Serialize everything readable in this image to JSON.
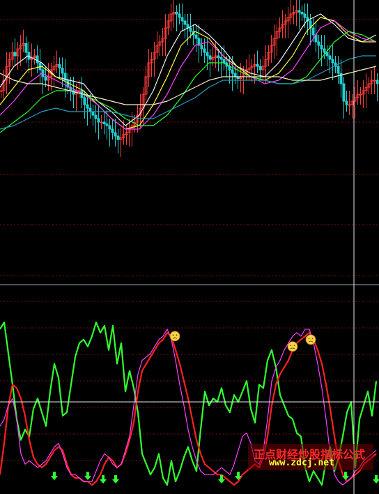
{
  "watermark": {
    "title": "正点财经炒股指标公式",
    "url": "www.zdcj.net"
  },
  "colors": {
    "background": "#000000",
    "grid": "#7a1010",
    "separator": "#9aa0b0",
    "candle_up": "#ff3b3b",
    "candle_down": "#22d0d0",
    "ma_white": "#f0f0f0",
    "ma_yellow": "#ffff40",
    "ma_magenta": "#ff40ff",
    "ma_green": "#30ff30",
    "ma_cyan": "#22a0c0",
    "ma_long": "#f5f0c0",
    "osc_green": "#30ff30",
    "osc_red": "#ff2020",
    "osc_magenta": "#ff40ff",
    "signal_arrow": "#30ff30",
    "warning_face": "#ffd24a"
  },
  "chart_data": [
    {
      "type": "candlestick",
      "panel": "price",
      "grid": true,
      "legend": "none",
      "ylim": [
        0,
        100
      ],
      "x": [
        0,
        4,
        8,
        12,
        16,
        20,
        24,
        28,
        32,
        36,
        40,
        44,
        48,
        52,
        56,
        60,
        64,
        68,
        72,
        76,
        80,
        84,
        88,
        92,
        96,
        100,
        104,
        108,
        112,
        116,
        120,
        124,
        128,
        132,
        136,
        140,
        144,
        148,
        152,
        156,
        160,
        164,
        168,
        172,
        176,
        180,
        184,
        188,
        192,
        196,
        200,
        204,
        208,
        212,
        216,
        220,
        224,
        228,
        232,
        236,
        240,
        244,
        248,
        252,
        256,
        260,
        264,
        268,
        272,
        276,
        280,
        284,
        288,
        292,
        296,
        300,
        304,
        308,
        312,
        316,
        320,
        324,
        328,
        332,
        336,
        340,
        344,
        348,
        352,
        356,
        360,
        364,
        368,
        372,
        376,
        380,
        384,
        388,
        392,
        396,
        400,
        404,
        408,
        412,
        416,
        420,
        424,
        428,
        432,
        436,
        440,
        444,
        448,
        452,
        456,
        460,
        464,
        468,
        472,
        476,
        480,
        484,
        488,
        492,
        496,
        500,
        504,
        508,
        512,
        516,
        520,
        524,
        528,
        532,
        536,
        540
      ],
      "close": [
        52,
        58,
        66,
        70,
        74,
        72,
        76,
        78,
        79,
        74,
        70,
        71,
        72,
        68,
        64,
        60,
        58,
        60,
        64,
        66,
        67,
        65,
        62,
        58,
        54,
        52,
        50,
        52,
        52,
        48,
        44,
        42,
        40,
        38,
        36,
        34,
        34,
        33,
        32,
        30,
        28,
        26,
        24,
        25,
        27,
        28,
        30,
        32,
        34,
        38,
        42,
        50,
        60,
        68,
        70,
        74,
        78,
        80,
        82,
        88,
        92,
        96,
        97,
        96,
        94,
        92,
        90,
        88,
        86,
        84,
        82,
        78,
        76,
        74,
        72,
        70,
        71,
        72,
        71,
        70,
        68,
        66,
        64,
        62,
        60,
        59,
        60,
        62,
        64,
        65,
        66,
        67,
        66,
        64,
        66,
        70,
        74,
        78,
        82,
        86,
        88,
        90,
        92,
        94,
        96,
        97,
        98,
        97,
        96,
        94,
        92,
        88,
        84,
        80,
        78,
        76,
        74,
        72,
        70,
        68,
        66,
        62,
        56,
        46,
        44,
        44,
        46,
        48,
        50,
        50,
        52,
        54,
        56,
        58,
        58,
        56
      ]
    },
    {
      "type": "line",
      "panel": "price-overlays",
      "series_count": 6,
      "ylim": [
        0,
        100
      ],
      "x": [
        0,
        20,
        40,
        60,
        80,
        100,
        120,
        140,
        160,
        180,
        200,
        220,
        240,
        260,
        280,
        300,
        320,
        340,
        360,
        380,
        400,
        420,
        440,
        460,
        480,
        500,
        520,
        540
      ],
      "series": [
        {
          "values": [
            54,
            66,
            72,
            68,
            60,
            58,
            56,
            46,
            40,
            32,
            38,
            52,
            72,
            86,
            90,
            84,
            76,
            66,
            62,
            60,
            68,
            80,
            92,
            96,
            90,
            82,
            80,
            84
          ]
        },
        {
          "values": [
            44,
            54,
            64,
            66,
            60,
            56,
            52,
            44,
            36,
            30,
            32,
            44,
            60,
            78,
            86,
            82,
            72,
            66,
            60,
            58,
            62,
            72,
            86,
            94,
            92,
            84,
            80,
            80
          ]
        },
        {
          "values": [
            38,
            46,
            56,
            62,
            58,
            54,
            50,
            44,
            36,
            30,
            30,
            38,
            50,
            66,
            78,
            80,
            72,
            64,
            60,
            56,
            58,
            64,
            76,
            88,
            92,
            86,
            82,
            80
          ]
        },
        {
          "values": [
            28,
            34,
            40,
            48,
            52,
            52,
            50,
            46,
            42,
            36,
            32,
            32,
            38,
            48,
            60,
            68,
            68,
            64,
            60,
            58,
            56,
            56,
            60,
            70,
            80,
            86,
            84,
            80
          ]
        },
        {
          "values": [
            30,
            32,
            36,
            40,
            42,
            40,
            40,
            40,
            40,
            38,
            36,
            36,
            40,
            44,
            48,
            54,
            58,
            58,
            58,
            58,
            56,
            56,
            58,
            62,
            66,
            70,
            72,
            72
          ]
        },
        {
          "values": [
            62,
            58,
            56,
            56,
            54,
            52,
            50,
            48,
            46,
            44,
            44,
            44,
            46,
            50,
            54,
            58,
            60,
            60,
            60,
            60,
            60,
            58,
            58,
            58,
            60,
            62,
            64,
            66
          ]
        }
      ]
    },
    {
      "type": "line",
      "panel": "oscillator",
      "grid": true,
      "legend": "none",
      "ylim": [
        0,
        100
      ],
      "x": [
        0,
        6,
        12,
        18,
        24,
        30,
        36,
        42,
        48,
        54,
        60,
        66,
        72,
        78,
        84,
        90,
        96,
        102,
        108,
        114,
        120,
        126,
        132,
        138,
        144,
        150,
        156,
        162,
        168,
        174,
        180,
        186,
        192,
        198,
        204,
        210,
        216,
        222,
        228,
        234,
        240,
        246,
        252,
        258,
        264,
        270,
        276,
        282,
        288,
        294,
        300,
        306,
        312,
        318,
        324,
        330,
        336,
        342,
        348,
        354,
        360,
        366,
        372,
        378,
        384,
        390,
        396,
        402,
        408,
        414,
        420,
        426,
        432,
        438,
        444,
        450,
        456,
        462,
        468,
        474,
        480,
        486,
        492,
        498,
        504,
        510,
        516,
        522,
        528,
        534,
        540
      ],
      "series": [
        {
          "values": [
            92,
            96,
            78,
            60,
            40,
            28,
            34,
            30,
            46,
            52,
            44,
            36,
            56,
            72,
            64,
            42,
            44,
            60,
            76,
            84,
            86,
            82,
            88,
            96,
            90,
            94,
            80,
            94,
            72,
            84,
            56,
            68,
            58,
            44,
            20,
            14,
            8,
            12,
            20,
            6,
            2,
            16,
            4,
            10,
            18,
            24,
            16,
            10,
            34,
            56,
            48,
            52,
            50,
            58,
            48,
            44,
            54,
            50,
            56,
            62,
            46,
            38,
            60,
            58,
            74,
            80,
            70,
            54,
            48,
            42,
            40,
            32,
            30,
            12,
            4,
            10,
            6,
            2,
            16,
            24,
            10,
            18,
            30,
            44,
            50,
            12,
            40,
            48,
            56,
            42,
            62
          ]
        },
        {
          "values": [
            8,
            26,
            48,
            60,
            58,
            52,
            42,
            28,
            18,
            14,
            12,
            14,
            18,
            22,
            24,
            22,
            14,
            8,
            6,
            6,
            4,
            4,
            2,
            4,
            8,
            14,
            18,
            16,
            12,
            14,
            20,
            28,
            38,
            56,
            68,
            72,
            76,
            80,
            84,
            86,
            90,
            88,
            80,
            72,
            62,
            52,
            40,
            28,
            20,
            14,
            12,
            10,
            8,
            8,
            6,
            4,
            2,
            4,
            8,
            10,
            12,
            14,
            12,
            18,
            30,
            48,
            60,
            66,
            70,
            74,
            80,
            84,
            86,
            88,
            90,
            86,
            80,
            72,
            60,
            46,
            30,
            16,
            8,
            4,
            6,
            8,
            10,
            14,
            16,
            18,
            20
          ]
        },
        {
          "values": [
            36,
            40,
            48,
            52,
            40,
            20,
            14,
            16,
            14,
            12,
            14,
            16,
            20,
            24,
            26,
            20,
            12,
            8,
            8,
            6,
            4,
            4,
            4,
            10,
            16,
            20,
            18,
            14,
            12,
            14,
            22,
            30,
            48,
            66,
            74,
            76,
            78,
            82,
            86,
            88,
            92,
            86,
            74,
            60,
            48,
            34,
            24,
            16,
            10,
            8,
            8,
            8,
            10,
            12,
            10,
            8,
            14,
            22,
            30,
            32,
            26,
            16,
            14,
            22,
            40,
            62,
            70,
            74,
            80,
            84,
            88,
            90,
            88,
            92,
            92,
            84,
            72,
            58,
            40,
            20,
            8,
            4,
            2,
            4,
            6,
            10,
            12,
            16,
            18,
            20,
            22
          ]
        }
      ]
    },
    {
      "type": "scatter",
      "panel": "oscillator-signals",
      "marker": "down-arrow",
      "x": [
        78,
        126,
        148,
        166,
        318,
        342,
        496,
        540
      ],
      "values": [
        4,
        4,
        2,
        2,
        2,
        4,
        4,
        2
      ]
    },
    {
      "type": "scatter",
      "panel": "oscillator-warnings",
      "marker": "face",
      "x": [
        251,
        420,
        446
      ],
      "values": [
        88,
        82,
        86
      ]
    }
  ]
}
